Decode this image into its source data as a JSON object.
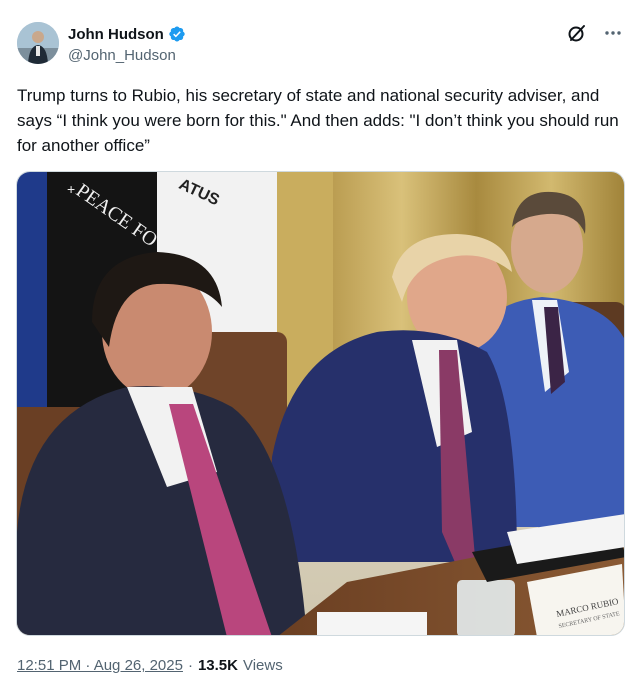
{
  "author": {
    "display_name": "John Hudson",
    "handle": "@John_Hudson",
    "verified": true,
    "verified_color": "#1d9bf0"
  },
  "header_icons": [
    "grok-icon",
    "more-icon"
  ],
  "tweet": {
    "text": "Trump turns to Rubio, his secretary of state and national security adviser, and says “I think you were born for this.\" And then adds: \"I don’t think you should run for another office”"
  },
  "media": {
    "flag_text_1": "PEACE FO",
    "flag_text_2": "ATUS",
    "flag_star": "+",
    "name_card_line1": "MARCO RUBIO",
    "name_card_line2": "SECRETARY OF STATE"
  },
  "meta": {
    "time": "12:51 PM · Aug 26, 2025",
    "separator": "·",
    "views_count": "13.5K",
    "views_label": "Views"
  }
}
